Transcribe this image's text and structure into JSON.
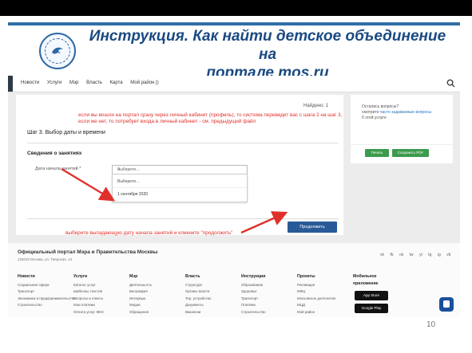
{
  "slide": {
    "title_line1": "Инструкция. Как найти детское объединение на",
    "title_line2_prefix": "портале ",
    "title_link": "mos.ru",
    "page_number": "10"
  },
  "portal": {
    "nav": [
      "Новости",
      "Услуги",
      "Мэр",
      "Власть",
      "Карта",
      "Мой район |)"
    ],
    "found": "Найдено: 1",
    "step_title": "Шаг 3. Выбор даты и времени",
    "section_title": "Сведения о занятиях",
    "date_label": "Дата начала занятий *",
    "select_placeholder": "Выберите...",
    "dropdown_options": [
      "Выберите...",
      "1 сентября 2020"
    ],
    "next_button": "Продолжить",
    "sidebar": {
      "question": "Остались вопросы?",
      "faq_prefix": "смотрите ",
      "faq_link": "часто задаваемые вопросы",
      "service": "б этой услуге",
      "print_button": "Печать",
      "pdf_button": "Сохранить PDF"
    }
  },
  "annotations": {
    "note1": "если вы вошли на портал сразу через личный кабинет (профиль), то система переведет вас с шага 2 на шаг 3, если же нет, то потребует входа в личный кабинет - см. предыдущий файл",
    "note2": "выберите выпадающую дату начала занятий и кликните \"продолжить\""
  },
  "footer": {
    "title": "Официальный портал Мэра и Правительства Москвы",
    "address": "125032 Москва, ул. Тверская, 13",
    "social": [
      "vk",
      "fb",
      "ok",
      "tw",
      "yt",
      "tg",
      "ig",
      "vb"
    ],
    "columns": [
      {
        "heading": "Новости",
        "items": [
          "Социальная сфера",
          "Транспорт",
          "Экономика и предпринимательство",
          "Строительство"
        ]
      },
      {
        "heading": "Услуги",
        "items": [
          "Каталог услуг",
          "Шаблоны текстов",
          "Вопросы и ответы",
          "Мои платежи",
          "Оплата услуг ЖКХ"
        ]
      },
      {
        "heading": "Мэр",
        "items": [
          "Деятельность",
          "Биография",
          "Интервью",
          "Медиа",
          "Обращения"
        ]
      },
      {
        "heading": "Власть",
        "items": [
          "Структура",
          "Органы власти",
          "Тер. устройство",
          "Документы",
          "Вакансии"
        ]
      },
      {
        "heading": "Инструкции",
        "items": [
          "Образование",
          "Здоровье",
          "Транспорт",
          "Платежи",
          "Строительство"
        ]
      },
      {
        "heading": "Проекты",
        "items": [
          "Реновация",
          "МФЦ",
          "Московское долголетие",
          "МЦД",
          "Мой район"
        ]
      },
      {
        "heading": "Мобильное приложение",
        "items": []
      }
    ],
    "app_store": "App Store",
    "google_play": "Google Play"
  },
  "colors": {
    "title": "#1a4a82",
    "annotation_red": "#e0302b",
    "button_blue": "#285a97",
    "button_green": "#3c9b4d"
  }
}
